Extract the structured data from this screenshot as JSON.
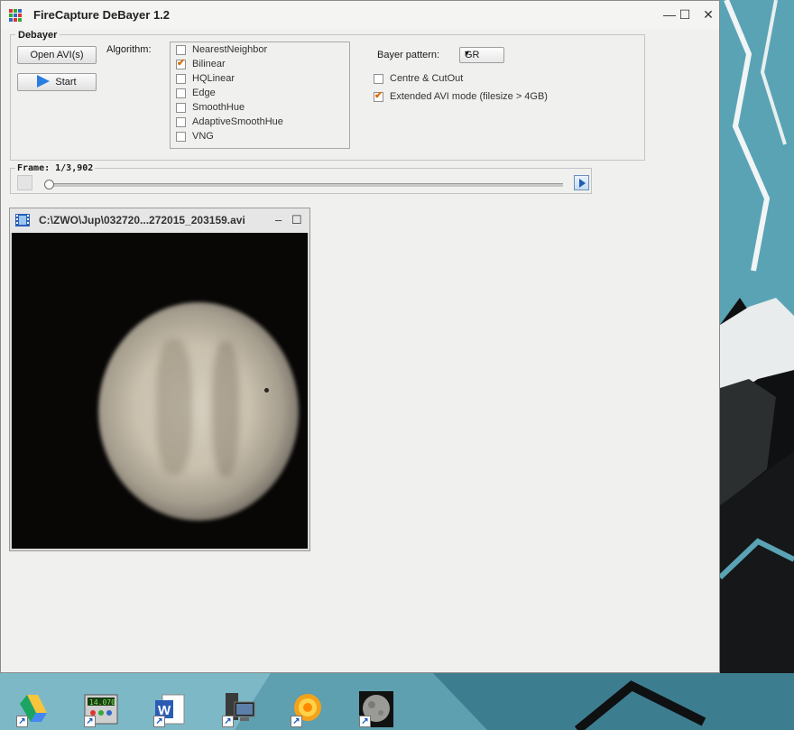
{
  "window": {
    "title": "FireCapture DeBayer 1.2",
    "minimize_glyph": "—",
    "maximize_glyph": "☐",
    "close_glyph": "✕"
  },
  "debayer": {
    "group_label": "Debayer",
    "open_button": "Open AVI(s)",
    "start_button": "Start",
    "algorithm_label": "Algorithm:",
    "algorithms": [
      {
        "label": "NearestNeighbor",
        "checked": false
      },
      {
        "label": "Bilinear",
        "checked": true
      },
      {
        "label": "HQLinear",
        "checked": false
      },
      {
        "label": "Edge",
        "checked": false
      },
      {
        "label": "SmoothHue",
        "checked": false
      },
      {
        "label": "AdaptiveSmoothHue",
        "checked": false
      },
      {
        "label": "VNG",
        "checked": false
      }
    ],
    "bayer_label": "Bayer pattern:",
    "bayer_value": "GR",
    "centre_cutout": {
      "label": "Centre & CutOut",
      "checked": false
    },
    "extended_avi": {
      "label": "Extended AVI mode (filesize > 4GB)",
      "checked": true
    }
  },
  "frame": {
    "label": "Frame: 1/3,902",
    "current": 1,
    "total": 3902
  },
  "video_window": {
    "title": "C:\\ZWO\\Jup\\032720...272015_203159.avi"
  },
  "taskbar": {
    "icons": [
      "google-drive-icon",
      "meter-app-icon",
      "word-icon",
      "computer-icon",
      "firecapture-sun-icon",
      "moon-icon"
    ]
  },
  "colors": {
    "accent_check": "#d96b00",
    "desktop_cyan": "#5fa7b8"
  }
}
